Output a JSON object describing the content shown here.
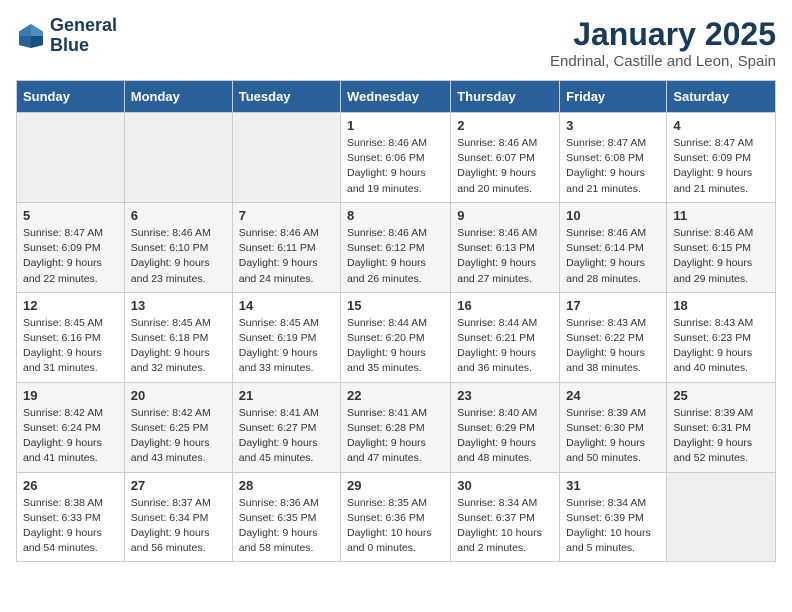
{
  "logo": {
    "line1": "General",
    "line2": "Blue"
  },
  "title": "January 2025",
  "location": "Endrinal, Castille and Leon, Spain",
  "weekdays": [
    "Sunday",
    "Monday",
    "Tuesday",
    "Wednesday",
    "Thursday",
    "Friday",
    "Saturday"
  ],
  "weeks": [
    [
      {
        "day": "",
        "info": ""
      },
      {
        "day": "",
        "info": ""
      },
      {
        "day": "",
        "info": ""
      },
      {
        "day": "1",
        "info": "Sunrise: 8:46 AM\nSunset: 6:06 PM\nDaylight: 9 hours\nand 19 minutes."
      },
      {
        "day": "2",
        "info": "Sunrise: 8:46 AM\nSunset: 6:07 PM\nDaylight: 9 hours\nand 20 minutes."
      },
      {
        "day": "3",
        "info": "Sunrise: 8:47 AM\nSunset: 6:08 PM\nDaylight: 9 hours\nand 21 minutes."
      },
      {
        "day": "4",
        "info": "Sunrise: 8:47 AM\nSunset: 6:09 PM\nDaylight: 9 hours\nand 21 minutes."
      }
    ],
    [
      {
        "day": "5",
        "info": "Sunrise: 8:47 AM\nSunset: 6:09 PM\nDaylight: 9 hours\nand 22 minutes."
      },
      {
        "day": "6",
        "info": "Sunrise: 8:46 AM\nSunset: 6:10 PM\nDaylight: 9 hours\nand 23 minutes."
      },
      {
        "day": "7",
        "info": "Sunrise: 8:46 AM\nSunset: 6:11 PM\nDaylight: 9 hours\nand 24 minutes."
      },
      {
        "day": "8",
        "info": "Sunrise: 8:46 AM\nSunset: 6:12 PM\nDaylight: 9 hours\nand 26 minutes."
      },
      {
        "day": "9",
        "info": "Sunrise: 8:46 AM\nSunset: 6:13 PM\nDaylight: 9 hours\nand 27 minutes."
      },
      {
        "day": "10",
        "info": "Sunrise: 8:46 AM\nSunset: 6:14 PM\nDaylight: 9 hours\nand 28 minutes."
      },
      {
        "day": "11",
        "info": "Sunrise: 8:46 AM\nSunset: 6:15 PM\nDaylight: 9 hours\nand 29 minutes."
      }
    ],
    [
      {
        "day": "12",
        "info": "Sunrise: 8:45 AM\nSunset: 6:16 PM\nDaylight: 9 hours\nand 31 minutes."
      },
      {
        "day": "13",
        "info": "Sunrise: 8:45 AM\nSunset: 6:18 PM\nDaylight: 9 hours\nand 32 minutes."
      },
      {
        "day": "14",
        "info": "Sunrise: 8:45 AM\nSunset: 6:19 PM\nDaylight: 9 hours\nand 33 minutes."
      },
      {
        "day": "15",
        "info": "Sunrise: 8:44 AM\nSunset: 6:20 PM\nDaylight: 9 hours\nand 35 minutes."
      },
      {
        "day": "16",
        "info": "Sunrise: 8:44 AM\nSunset: 6:21 PM\nDaylight: 9 hours\nand 36 minutes."
      },
      {
        "day": "17",
        "info": "Sunrise: 8:43 AM\nSunset: 6:22 PM\nDaylight: 9 hours\nand 38 minutes."
      },
      {
        "day": "18",
        "info": "Sunrise: 8:43 AM\nSunset: 6:23 PM\nDaylight: 9 hours\nand 40 minutes."
      }
    ],
    [
      {
        "day": "19",
        "info": "Sunrise: 8:42 AM\nSunset: 6:24 PM\nDaylight: 9 hours\nand 41 minutes."
      },
      {
        "day": "20",
        "info": "Sunrise: 8:42 AM\nSunset: 6:25 PM\nDaylight: 9 hours\nand 43 minutes."
      },
      {
        "day": "21",
        "info": "Sunrise: 8:41 AM\nSunset: 6:27 PM\nDaylight: 9 hours\nand 45 minutes."
      },
      {
        "day": "22",
        "info": "Sunrise: 8:41 AM\nSunset: 6:28 PM\nDaylight: 9 hours\nand 47 minutes."
      },
      {
        "day": "23",
        "info": "Sunrise: 8:40 AM\nSunset: 6:29 PM\nDaylight: 9 hours\nand 48 minutes."
      },
      {
        "day": "24",
        "info": "Sunrise: 8:39 AM\nSunset: 6:30 PM\nDaylight: 9 hours\nand 50 minutes."
      },
      {
        "day": "25",
        "info": "Sunrise: 8:39 AM\nSunset: 6:31 PM\nDaylight: 9 hours\nand 52 minutes."
      }
    ],
    [
      {
        "day": "26",
        "info": "Sunrise: 8:38 AM\nSunset: 6:33 PM\nDaylight: 9 hours\nand 54 minutes."
      },
      {
        "day": "27",
        "info": "Sunrise: 8:37 AM\nSunset: 6:34 PM\nDaylight: 9 hours\nand 56 minutes."
      },
      {
        "day": "28",
        "info": "Sunrise: 8:36 AM\nSunset: 6:35 PM\nDaylight: 9 hours\nand 58 minutes."
      },
      {
        "day": "29",
        "info": "Sunrise: 8:35 AM\nSunset: 6:36 PM\nDaylight: 10 hours\nand 0 minutes."
      },
      {
        "day": "30",
        "info": "Sunrise: 8:34 AM\nSunset: 6:37 PM\nDaylight: 10 hours\nand 2 minutes."
      },
      {
        "day": "31",
        "info": "Sunrise: 8:34 AM\nSunset: 6:39 PM\nDaylight: 10 hours\nand 5 minutes."
      },
      {
        "day": "",
        "info": ""
      }
    ]
  ]
}
